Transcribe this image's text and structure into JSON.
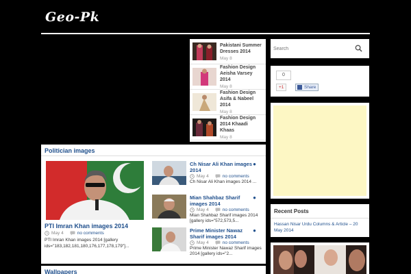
{
  "site": {
    "logo": "Geo-Pk"
  },
  "fashion_posts": [
    {
      "title": "Pakistani Summer Dresses 2014",
      "date": "May 8"
    },
    {
      "title": "Fashion Design Aeisha Varsey 2014",
      "date": "May 8"
    },
    {
      "title": "Fashion Design Asifa & Nabeel 2014",
      "date": "May 8"
    },
    {
      "title": "Fashion Design 2014 Khaadi Khaas",
      "date": "May 8"
    }
  ],
  "politician": {
    "heading": "Politician images",
    "featured": {
      "title": "PTI Imran Khan images 2014",
      "date": "May 4",
      "comments": "no comments",
      "excerpt": "PTI Imran Khan images 2014 [gallery ids=\"183,182,181,180,176,177,178,179\"]..."
    },
    "posts": [
      {
        "title": "Ch Nisar Ali Khan images 2014",
        "date": "May 4",
        "comments": "no comments",
        "excerpt": "Ch Nisar Ali Khan images 2014 ..."
      },
      {
        "title": "Mian Shahbaz Sharif images 2014",
        "date": "May 4",
        "comments": "no comments",
        "excerpt": "Mian Shahbaz Sharif images 2014 [gallery ids=\"572,573,5..."
      },
      {
        "title": "Prime Minister Nawaz Sharif images 2014",
        "date": "May 4",
        "comments": "no comments",
        "excerpt": "Prime Minister Nawaz Sharif images 2014 [gallery ids=\"2..."
      }
    ]
  },
  "wallpapers": {
    "heading": "Wallpapers"
  },
  "sidebar": {
    "search_placeholder": "Search",
    "like_count": "0",
    "gplus_label": "+1",
    "share_label": "Share",
    "recent_heading": "Recent Posts",
    "recent_posts": [
      "Hassan Nisar Urdu Columns & Article – 20 May 2014"
    ]
  },
  "icons": {
    "search": "search-icon",
    "clock": "clock-icon",
    "comment": "comment-icon",
    "facebook": "facebook-icon"
  }
}
